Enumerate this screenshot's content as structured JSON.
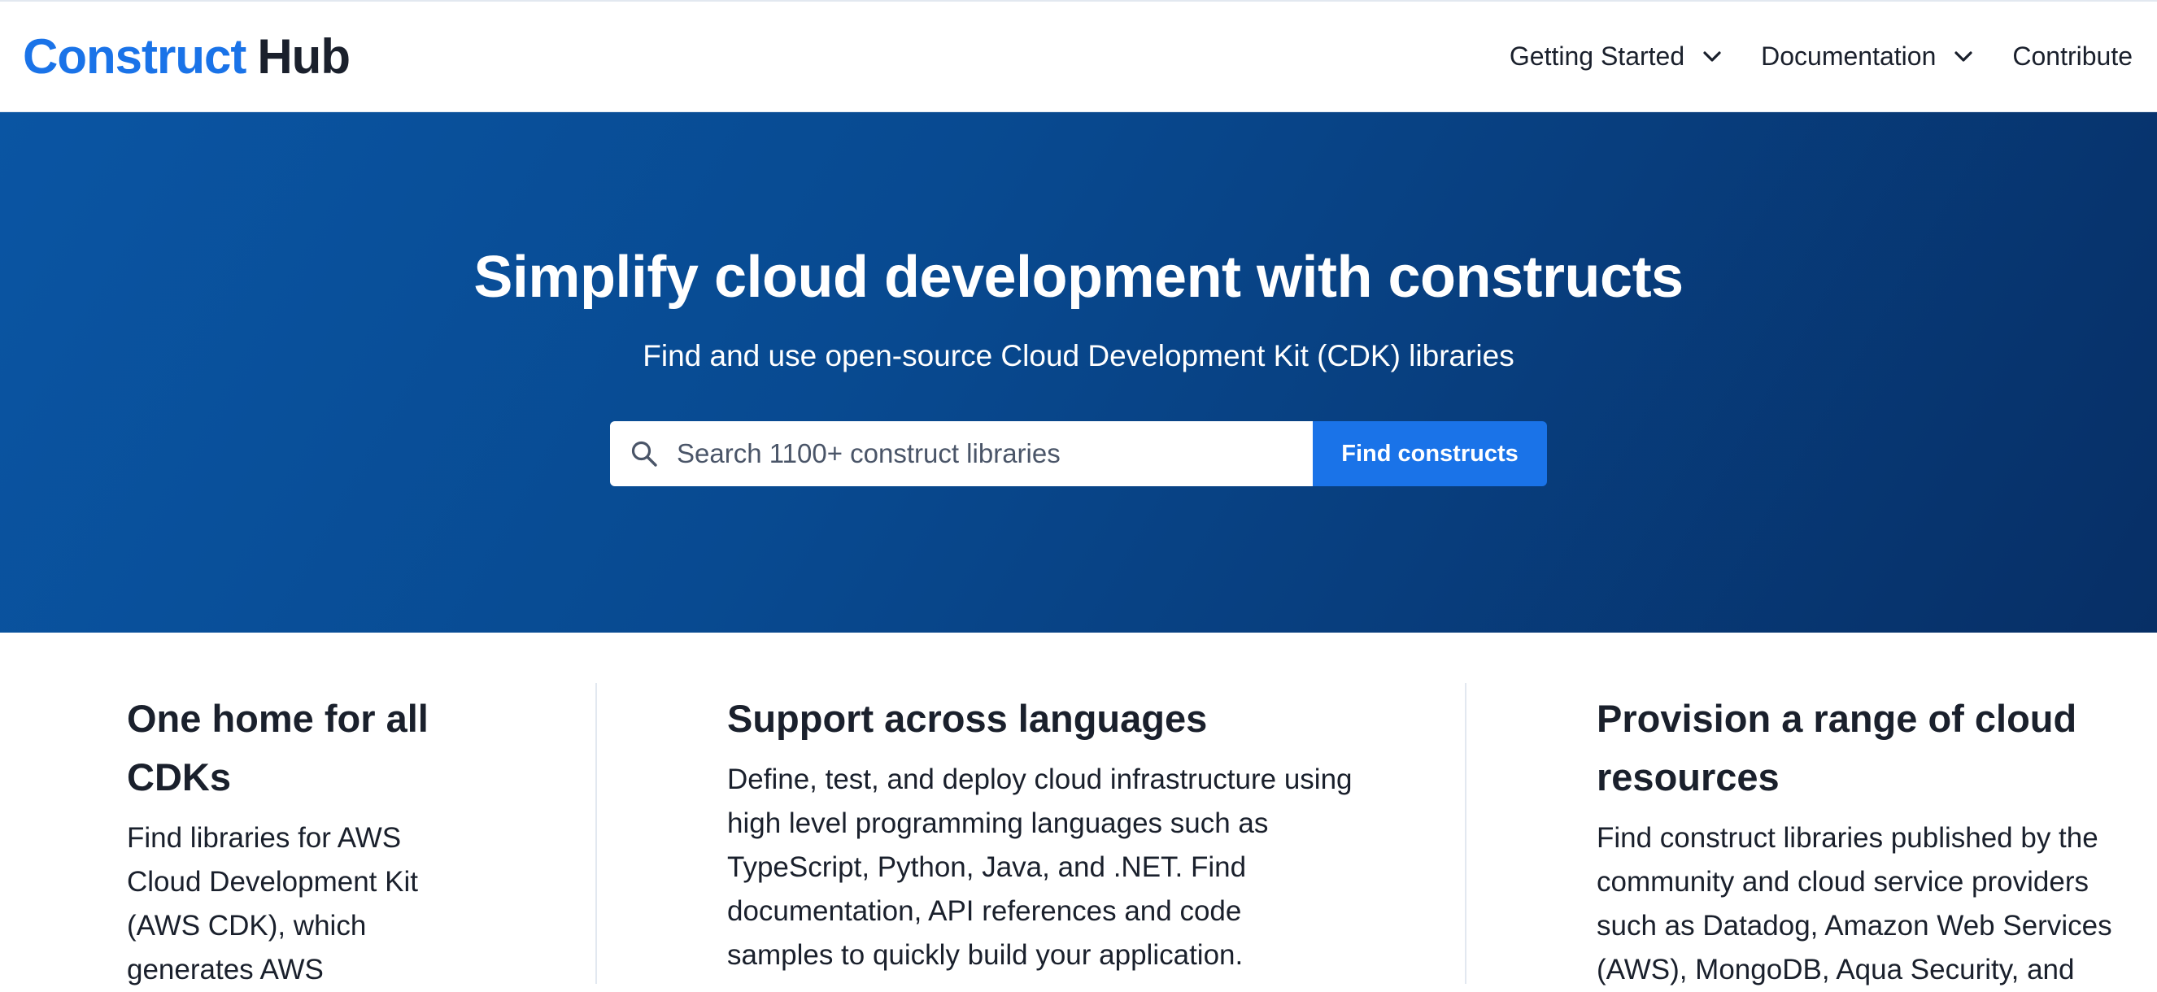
{
  "header": {
    "logo_brand": "Construct",
    "logo_suffix": "Hub",
    "nav": {
      "getting_started": "Getting Started",
      "documentation": "Documentation",
      "contribute": "Contribute"
    }
  },
  "hero": {
    "title": "Simplify cloud development with constructs",
    "subtitle": "Find and use open-source Cloud Development Kit (CDK) libraries",
    "search": {
      "placeholder": "Search 1100+ construct libraries",
      "value": "",
      "button_label": "Find constructs"
    }
  },
  "features": [
    {
      "title": "One home for all CDKs",
      "text": "Find libraries for AWS Cloud Development Kit (AWS CDK), which generates AWS"
    },
    {
      "title": "Support across languages",
      "text": "Define, test, and deploy cloud infrastructure using high level programming languages such as TypeScript, Python, Java, and .NET. Find documentation, API references and code samples to quickly build your application."
    },
    {
      "title": "Provision a range of cloud resources",
      "text": "Find construct libraries published by the community and cloud service providers such as Datadog, Amazon Web Services (AWS), MongoDB, Aqua Security, and"
    }
  ],
  "colors": {
    "brand_blue": "#1a73e8",
    "hero_start": "#0a55a3",
    "hero_end": "#072f66",
    "text_dark": "#1a202c"
  },
  "icons": {
    "search": "search-icon",
    "chevron": "chevron-down-icon"
  }
}
